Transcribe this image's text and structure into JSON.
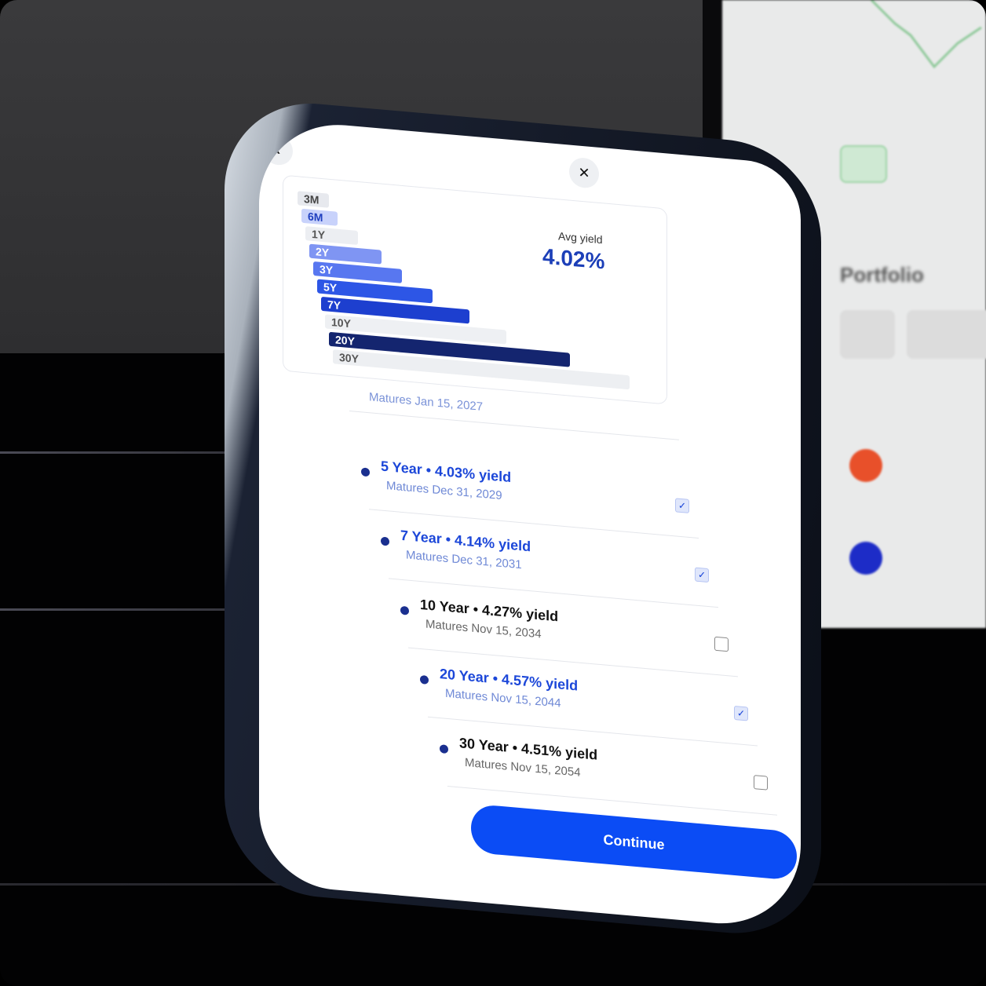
{
  "chart": {
    "avg_label": "Avg yield",
    "avg_value": "4.02%",
    "bars": [
      {
        "label": "3M",
        "level": 0.06,
        "fill": "#e7e9ee",
        "text": "#444"
      },
      {
        "label": "6M",
        "level": 0.11,
        "fill": "#c8d2fb",
        "text": "#1f3fbf"
      },
      {
        "label": "1Y",
        "level": 0.16,
        "fill": "#eceef2",
        "text": "#555"
      },
      {
        "label": "2Y",
        "level": 0.22,
        "fill": "#7f95f3",
        "text": "#fff"
      },
      {
        "label": "3Y",
        "level": 0.27,
        "fill": "#5877f0",
        "text": "#fff"
      },
      {
        "label": "5Y",
        "level": 0.35,
        "fill": "#2d56e6",
        "text": "#fff"
      },
      {
        "label": "7Y",
        "level": 0.45,
        "fill": "#1d3fcf",
        "text": "#fff"
      },
      {
        "label": "10Y",
        "level": 0.55,
        "fill": "#eef0f3",
        "text": "#555"
      },
      {
        "label": "20Y",
        "level": 0.73,
        "fill": "#14256f",
        "text": "#fff"
      },
      {
        "label": "30Y",
        "level": 0.9,
        "fill": "#edeff2",
        "text": "#555"
      }
    ]
  },
  "list": {
    "partial_sub": "Matures Jan 15, 2027",
    "items": [
      {
        "title": "5 Year • 4.03% yield",
        "sub": "Matures Dec 31, 2029",
        "selected": true
      },
      {
        "title": "7 Year • 4.14% yield",
        "sub": "Matures Dec 31, 2031",
        "selected": true
      },
      {
        "title": "10 Year • 4.27% yield",
        "sub": "Matures Nov 15, 2034",
        "selected": false
      },
      {
        "title": "20 Year • 4.57% yield",
        "sub": "Matures Nov 15, 2044",
        "selected": true
      },
      {
        "title": "30 Year • 4.51% yield",
        "sub": "Matures Nov 15, 2054",
        "selected": false
      }
    ]
  },
  "nav": {
    "back_icon": "chevron-left-icon",
    "close_icon": "close-icon"
  },
  "continue_label": "Continue",
  "colors": {
    "selected": "#1c47d9",
    "unselected": "#111111",
    "accent": "#0b4cf5"
  },
  "background": {
    "right_labels": [
      "Portfolio"
    ]
  }
}
